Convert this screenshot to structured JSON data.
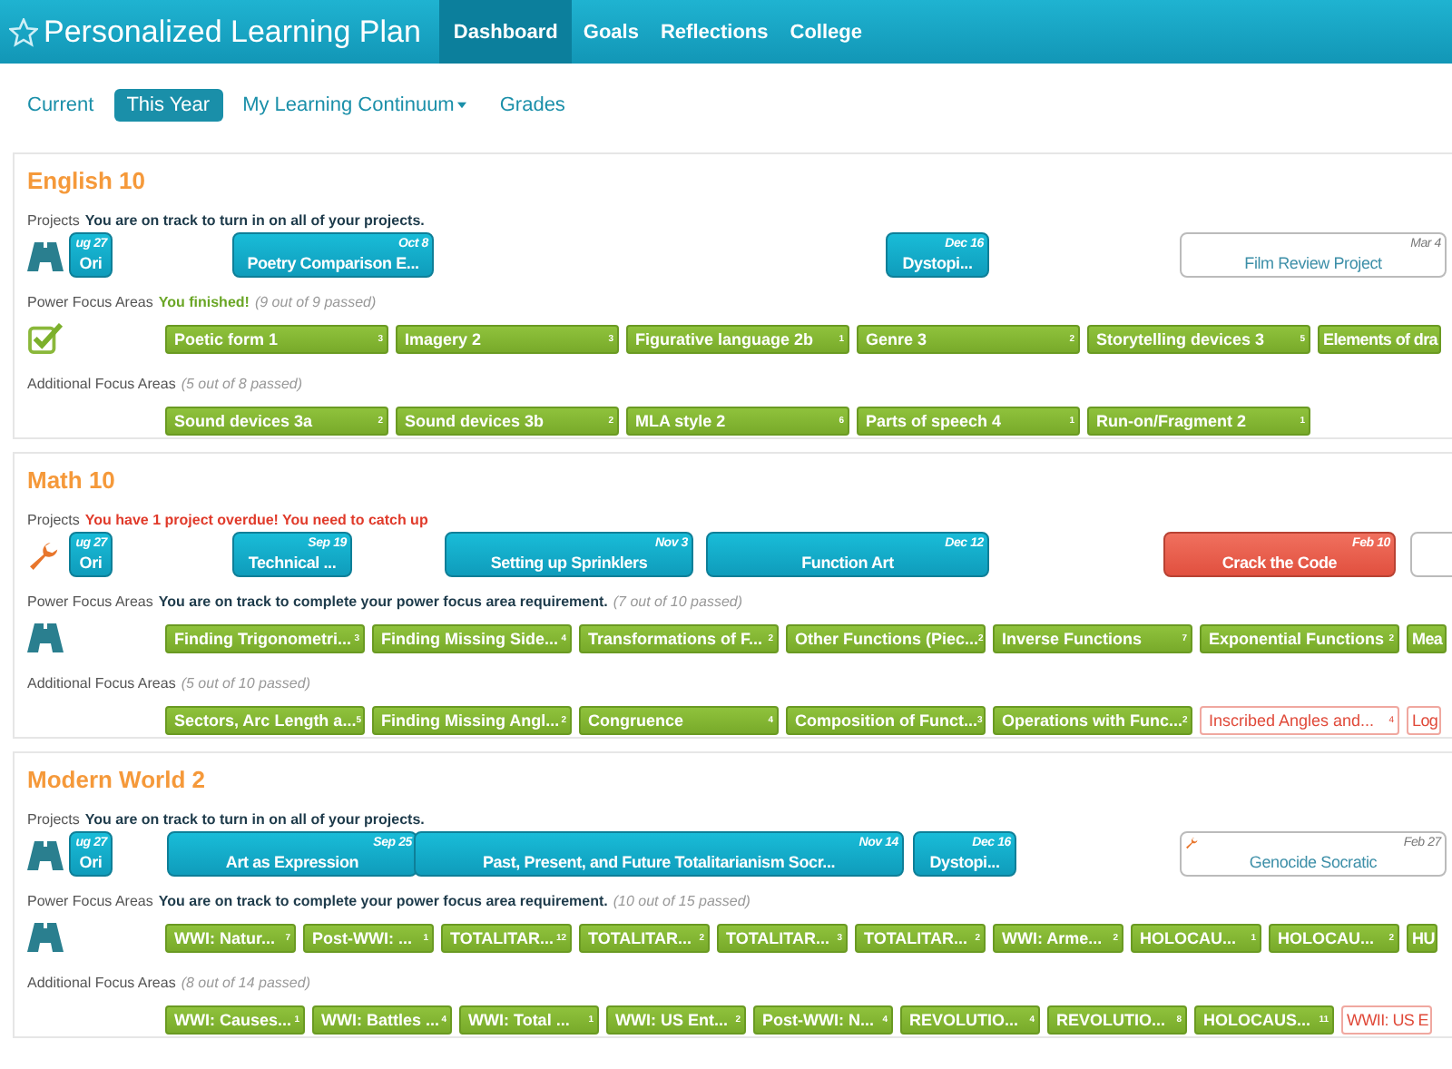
{
  "app": {
    "title": "Personalized Learning Plan"
  },
  "nav": [
    {
      "label": "Dashboard",
      "selected": true
    },
    {
      "label": "Goals",
      "selected": false
    },
    {
      "label": "Reflections",
      "selected": false
    },
    {
      "label": "College",
      "selected": false
    }
  ],
  "subnav": [
    {
      "label": "Current",
      "selected": false,
      "dropdown": false
    },
    {
      "label": "This Year",
      "selected": true,
      "dropdown": false
    },
    {
      "label": "My Learning Continuum",
      "selected": false,
      "dropdown": true
    },
    {
      "label": "Grades",
      "selected": false,
      "dropdown": false
    }
  ],
  "courses": [
    {
      "title": "English 10",
      "projects": {
        "label": "Projects",
        "kind": "track",
        "message": "You are on track to turn in on all of your projects.",
        "items": [
          {
            "kind": "active",
            "date": "ug 27",
            "title": "Ori",
            "wrench": false
          },
          {
            "kind": "active",
            "date": "Oct 8",
            "title": "Poetry Comparison E...",
            "wrench": false
          },
          {
            "kind": "active",
            "date": "Dec 16",
            "title": "Dystopi...",
            "wrench": false
          },
          {
            "kind": "upcoming",
            "date": "Mar 4",
            "title": "Film Review Project",
            "wrench": false
          }
        ]
      },
      "power": {
        "label": "Power Focus Areas",
        "kind": "finished",
        "message": "You finished!",
        "count": "(9 out of 9 passed)",
        "items": [
          {
            "label": "Poetic form 1",
            "count": "3",
            "passed": true
          },
          {
            "label": "Imagery 2",
            "count": "3",
            "passed": true
          },
          {
            "label": "Figurative language 2b",
            "count": "1",
            "passed": true
          },
          {
            "label": "Genre 3",
            "count": "2",
            "passed": true
          },
          {
            "label": "Storytelling devices 3",
            "count": "5",
            "passed": true
          },
          {
            "label": "Elements of dra",
            "passed": true
          }
        ]
      },
      "additional": {
        "label": "Additional Focus Areas",
        "count": "(5 out of 8 passed)",
        "items": [
          {
            "label": "Sound devices 3a",
            "count": "2",
            "passed": true
          },
          {
            "label": "Sound devices 3b",
            "count": "2",
            "passed": true
          },
          {
            "label": "MLA style 2",
            "count": "6",
            "passed": true
          },
          {
            "label": "Parts of speech 4",
            "count": "1",
            "passed": true
          },
          {
            "label": "Run-on/Fragment 2",
            "count": "1",
            "passed": true
          }
        ]
      }
    },
    {
      "title": "Math 10",
      "projects": {
        "label": "Projects",
        "kind": "overdue",
        "message": "You have 1 project overdue! You need to catch up",
        "items": [
          {
            "kind": "active",
            "date": "ug 27",
            "title": "Ori",
            "wrench": false
          },
          {
            "kind": "active",
            "date": "Sep 19",
            "title": "Technical ...",
            "wrench": false
          },
          {
            "kind": "active",
            "date": "Nov 3",
            "title": "Setting up Sprinklers",
            "wrench": false
          },
          {
            "kind": "active",
            "date": "Dec 12",
            "title": "Function Art",
            "wrench": false
          },
          {
            "kind": "overdue",
            "date": "Feb 10",
            "title": "Crack the Code",
            "wrench": false
          },
          {
            "kind": "upcoming",
            "wrench": false
          }
        ]
      },
      "power": {
        "label": "Power Focus Areas",
        "kind": "track",
        "message": "You are on track to complete your power focus area requirement.",
        "count": "(7 out of 10 passed)",
        "items": [
          {
            "label": "Finding Trigonometri...",
            "count": "3",
            "passed": true
          },
          {
            "label": "Finding Missing Side...",
            "count": "4",
            "passed": true
          },
          {
            "label": "Transformations of F...",
            "count": "2",
            "passed": true
          },
          {
            "label": "Other Functions (Piec...",
            "count": "2",
            "passed": true
          },
          {
            "label": "Inverse Functions",
            "count": "7",
            "passed": true
          },
          {
            "label": "Exponential Functions",
            "count": "2",
            "passed": true
          },
          {
            "label": "Mea",
            "passed": true
          }
        ]
      },
      "additional": {
        "label": "Additional Focus Areas",
        "count": "(5 out of 10 passed)",
        "items": [
          {
            "label": "Sectors, Arc Length a...",
            "count": "5",
            "passed": true
          },
          {
            "label": "Finding Missing Angl...",
            "count": "2",
            "passed": true
          },
          {
            "label": "Congruence",
            "count": "4",
            "passed": true
          },
          {
            "label": "Composition of Funct...",
            "count": "3",
            "passed": true
          },
          {
            "label": "Operations with Func...",
            "count": "2",
            "passed": true
          },
          {
            "label": "Inscribed Angles and...",
            "count": "4",
            "passed": false
          },
          {
            "label": "Log",
            "passed": false
          }
        ]
      }
    },
    {
      "title": "Modern World 2",
      "projects": {
        "label": "Projects",
        "kind": "track",
        "message": "You are on track to turn in on all of your projects.",
        "items": [
          {
            "kind": "active",
            "date": "ug 27",
            "title": "Ori",
            "wrench": false
          },
          {
            "kind": "active",
            "date": "Sep 25",
            "title": "Art as Expression",
            "wrench": false
          },
          {
            "kind": "active",
            "date": "Nov 14",
            "title": "Past, Present, and Future Totalitarianism Socr...",
            "wrench": false
          },
          {
            "kind": "active",
            "date": "Dec 16",
            "title": "Dystopi...",
            "wrench": false
          },
          {
            "kind": "upcoming",
            "date": "Feb 27",
            "title": "Genocide Socratic",
            "wrench": true
          }
        ]
      },
      "power": {
        "label": "Power Focus Areas",
        "kind": "track",
        "message": "You are on track to complete your power focus area requirement.",
        "count": "(10 out of 15 passed)",
        "items": [
          {
            "label": "WWI: Natur...",
            "count": "7",
            "passed": true
          },
          {
            "label": "Post-WWI: ...",
            "count": "1",
            "passed": true
          },
          {
            "label": "TOTALITAR...",
            "count": "12",
            "passed": true
          },
          {
            "label": "TOTALITAR...",
            "count": "2",
            "passed": true
          },
          {
            "label": "TOTALITAR...",
            "count": "3",
            "passed": true
          },
          {
            "label": "TOTALITAR...",
            "count": "2",
            "passed": true
          },
          {
            "label": "WWI: Arme...",
            "count": "2",
            "passed": true
          },
          {
            "label": "HOLOCAU...",
            "count": "1",
            "passed": true
          },
          {
            "label": "HOLOCAU...",
            "count": "2",
            "passed": true
          },
          {
            "label": "HU",
            "passed": true
          }
        ]
      },
      "additional": {
        "label": "Additional Focus Areas",
        "count": "(8 out of 14 passed)",
        "items": [
          {
            "label": "WWI: Causes...",
            "count": "1",
            "passed": true
          },
          {
            "label": "WWI: Battles ...",
            "count": "4",
            "passed": true
          },
          {
            "label": "WWI: Total ...",
            "count": "1",
            "passed": true
          },
          {
            "label": "WWI: US Ent...",
            "count": "2",
            "passed": true
          },
          {
            "label": "Post-WWI: N...",
            "count": "4",
            "passed": true
          },
          {
            "label": "REVOLUTIO...",
            "count": "4",
            "passed": true
          },
          {
            "label": "REVOLUTIO...",
            "count": "8",
            "passed": true
          },
          {
            "label": "HOLOCAUS...",
            "count": "11",
            "passed": true
          },
          {
            "label": "WWII: US E",
            "passed": false
          }
        ]
      }
    }
  ]
}
